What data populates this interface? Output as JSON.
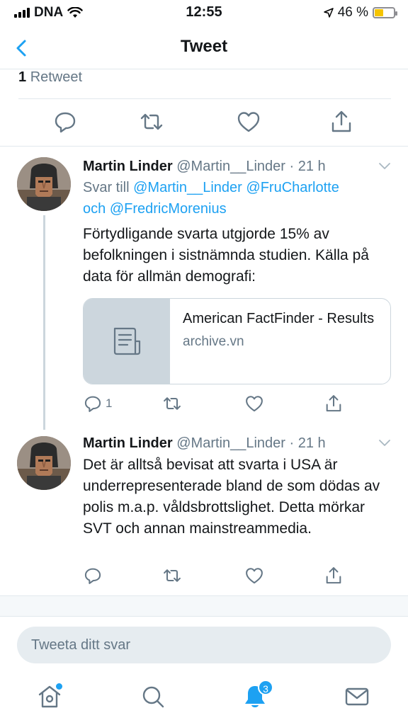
{
  "status_bar": {
    "carrier": "DNA",
    "time": "12:55",
    "battery_percent": "46 %",
    "battery_level": 0.46
  },
  "nav": {
    "title": "Tweet"
  },
  "retweets": {
    "count": "1",
    "label": "Retweet"
  },
  "tweets": [
    {
      "name": "Martin Linder",
      "meta": "@Martin__Linder · 21 h",
      "reply_prefix": "Svar till ",
      "reply_mention_1": "@Martin__Linder",
      "reply_mention_2": "@FruCharlotte",
      "reply_and": "och ",
      "reply_mention_3": "@FredricMorenius",
      "text": "Förtydligande svarta utgjorde 15% av befolkningen i sistnämnda studien. Källa på data för allmän demografi:",
      "card": {
        "title": "American FactFinder - Results",
        "domain": "archive.vn"
      },
      "reply_count": "1"
    },
    {
      "name": "Martin Linder",
      "meta": "@Martin__Linder · 21 h",
      "text": "Det är alltså bevisat att svarta i USA är underrepresenterade bland de som dödas av polis m.a.p. våldsbrottslighet. Detta mörkar SVT och annan mainstreammedia."
    }
  ],
  "compose": {
    "placeholder": "Tweeta ditt svar"
  },
  "tabbar": {
    "notifications_badge": "3"
  },
  "colors": {
    "accent": "#1da1f2",
    "muted": "#657786",
    "border": "#e1e8ed"
  }
}
